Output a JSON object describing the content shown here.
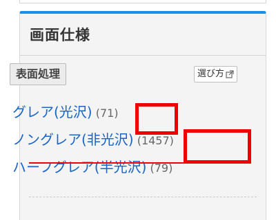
{
  "panel": {
    "title": "画面仕様",
    "section_label": "表面処理",
    "howto_label": "選び方",
    "accent_color": "#1a8fe8"
  },
  "options": [
    {
      "label": "グレア(光沢)",
      "count": "(71)"
    },
    {
      "label": "ノングレア(非光沢)",
      "count": "(1457)"
    },
    {
      "label": "ハーフグレア(半光沢)",
      "count": "(79)"
    }
  ],
  "annotations": {
    "highlight_color": "#ee0000"
  },
  "icons": {
    "howto_icon": "external-link-icon"
  }
}
